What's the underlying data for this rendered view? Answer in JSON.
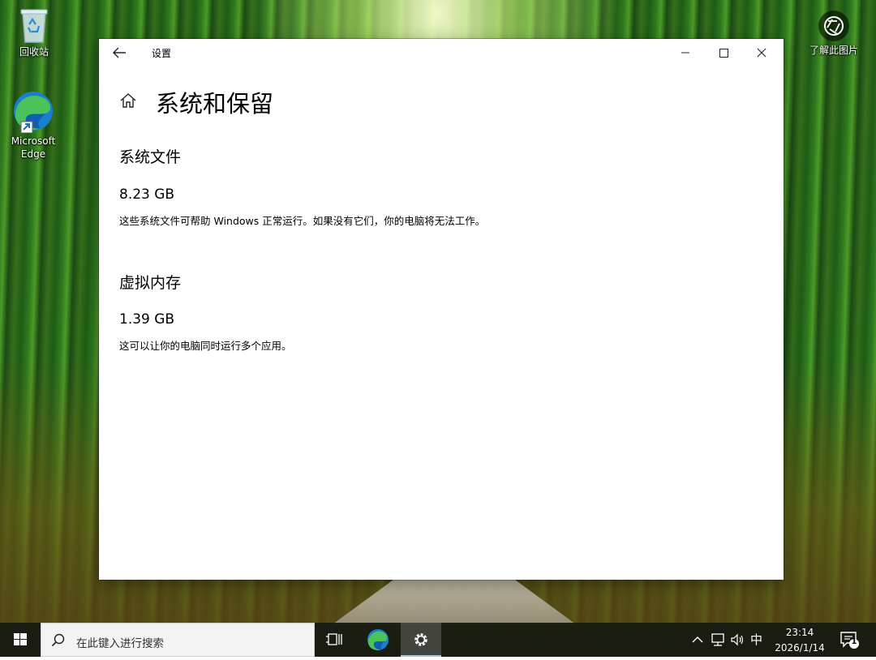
{
  "desktop": {
    "recycle_bin_label": "回收站",
    "edge_label": "Microsoft Edge",
    "about_image_label": "了解此图片"
  },
  "window": {
    "title": "设置",
    "page_title": "系统和保留",
    "sections": [
      {
        "heading": "系统文件",
        "size": "8.23 GB",
        "description": "这些系统文件可帮助 Windows 正常运行。如果没有它们，你的电脑将无法工作。"
      },
      {
        "heading": "虚拟内存",
        "size": "1.39 GB",
        "description": "这可以让你的电脑同时运行多个应用。"
      }
    ]
  },
  "taskbar": {
    "search_placeholder": "在此键入进行搜索",
    "ime_indicator": "中",
    "time": "23:14",
    "date": "2026/1/14",
    "notification_count": "1"
  },
  "colors": {
    "edge_blue": "#1e88d8",
    "edge_green": "#4cc25a",
    "taskbar_bg": "#161a12",
    "window_bg": "#ffffff"
  }
}
